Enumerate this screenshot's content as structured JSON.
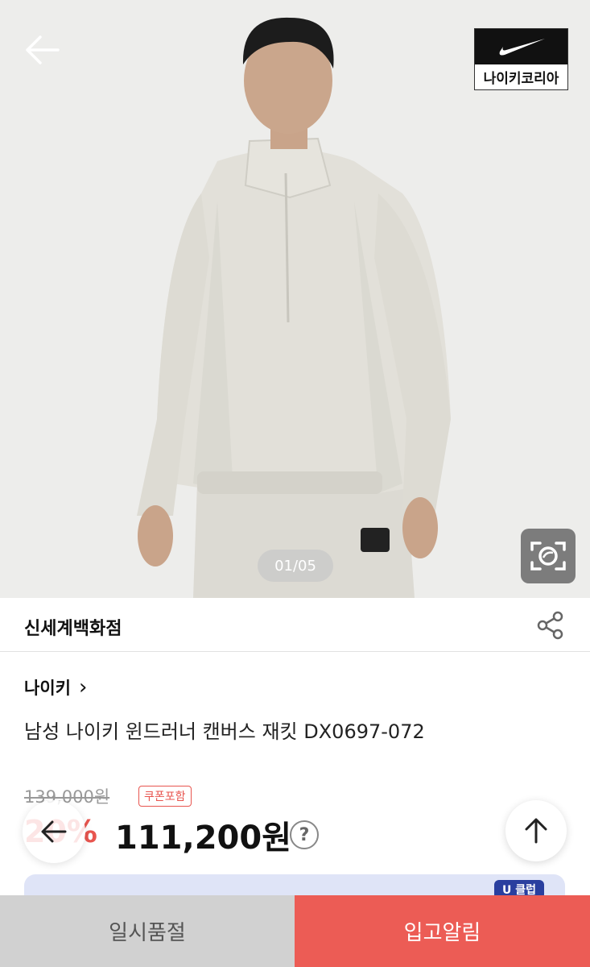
{
  "hero": {
    "counter": "01/05",
    "badge_text": "나이키코리아"
  },
  "store": {
    "name": "신세계백화점"
  },
  "product": {
    "brand": "나이키",
    "brand_chevron": "›",
    "title": "남성 나이키 윈드러너 캔버스 재킷 DX0697-072",
    "original_price": "139,000원",
    "coupon_label": "쿠폰포함",
    "discount": "20%",
    "sale_price": "111,200원",
    "help_symbol": "?"
  },
  "promo": {
    "tag": "U 클럽"
  },
  "actions": {
    "soldout_label": "일시품절",
    "notify_label": "입고알림"
  },
  "colors": {
    "accent": "#ec5c55",
    "disabled": "#d1d1d1"
  }
}
